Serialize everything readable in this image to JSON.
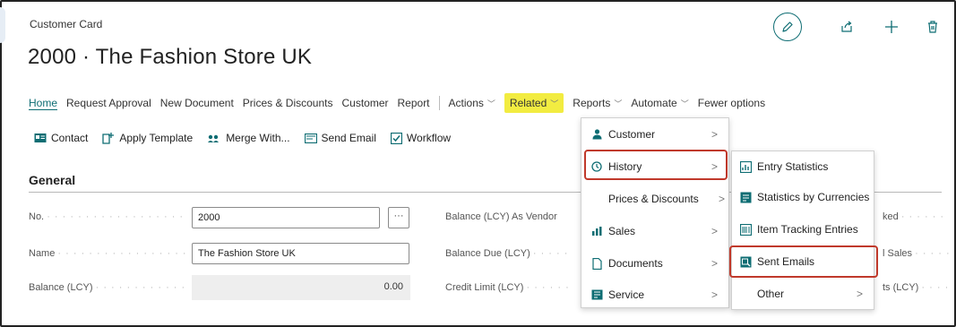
{
  "page": {
    "caption": "Customer Card",
    "title": "2000 · The Fashion Store UK"
  },
  "colors": {
    "accent": "#0e6d73",
    "highlight_yellow": "#f2ec41",
    "highlight_red": "#c0392b"
  },
  "top_icons": [
    "pencil-icon",
    "share-icon",
    "plus-icon",
    "trash-icon"
  ],
  "action_bar": {
    "home": "Home",
    "request_approval": "Request Approval",
    "new_document": "New Document",
    "prices_discounts": "Prices & Discounts",
    "customer": "Customer",
    "report": "Report",
    "actions": "Actions",
    "related": "Related",
    "reports": "Reports",
    "automate": "Automate",
    "fewer_options": "Fewer options"
  },
  "sub_bar": {
    "contact": "Contact",
    "apply_template": "Apply Template",
    "merge_with": "Merge With...",
    "send_email": "Send Email",
    "workflow": "Workflow"
  },
  "general": {
    "section_title": "General",
    "no_label": "No.",
    "no_value": "2000",
    "no_lookup": "···",
    "name_label": "Name",
    "name_value": "The Fashion Store UK",
    "balance_label": "Balance (LCY)",
    "balance_value": "0.00",
    "balance_vendor_label": "Balance (LCY) As Vendor",
    "balance_due_label": "Balance Due (LCY)",
    "credit_limit_label": "Credit Limit (LCY)",
    "right_col_1": "ked",
    "right_col_2": "l Sales",
    "right_col_3": "ts (LCY)"
  },
  "related_menu": {
    "items": [
      {
        "label": "Customer",
        "icon": "person-icon",
        "has_submenu": true
      },
      {
        "label": "History",
        "icon": "history-icon",
        "has_submenu": true
      },
      {
        "label": "Prices & Discounts",
        "icon": "",
        "has_submenu": true
      },
      {
        "label": "Sales",
        "icon": "sales-icon",
        "has_submenu": true
      },
      {
        "label": "Documents",
        "icon": "document-icon",
        "has_submenu": true
      },
      {
        "label": "Service",
        "icon": "service-icon",
        "has_submenu": true
      }
    ]
  },
  "history_menu": {
    "items": [
      {
        "label": "Entry Statistics",
        "icon": "statistics-icon"
      },
      {
        "label": "Statistics by Currencies",
        "icon": "currency-stats-icon"
      },
      {
        "label": "Item Tracking Entries",
        "icon": "tracking-icon"
      },
      {
        "label": "Sent Emails",
        "icon": "email-list-icon"
      },
      {
        "label": "Other",
        "icon": "",
        "has_submenu": true
      }
    ]
  }
}
